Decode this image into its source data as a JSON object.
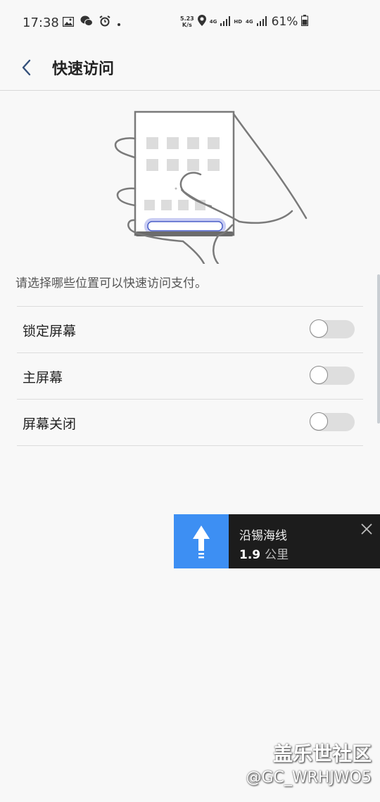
{
  "status_bar": {
    "time": "17:38",
    "net_speed_value": "5.23",
    "net_speed_unit": "K/s",
    "net_tag_1": "4G",
    "hd_tag": "HD",
    "net_tag_2": "4G",
    "battery_percent": "61%",
    "icons": [
      "gallery-icon",
      "wechat-icon",
      "alarm-icon",
      "dot-icon",
      "location-icon",
      "signal-icon",
      "battery-icon"
    ]
  },
  "app_bar": {
    "title": "快速访问"
  },
  "description": "请选择哪些位置可以快速访问支付。",
  "settings": [
    {
      "label": "锁定屏幕",
      "enabled": false
    },
    {
      "label": "主屏幕",
      "enabled": false
    },
    {
      "label": "屏幕关闭",
      "enabled": false
    }
  ],
  "navigation": {
    "street": "沿锡海线",
    "distance": "1.9",
    "unit": "公里",
    "accent_color": "#3d8ff3"
  },
  "watermark": {
    "title": "盖乐世社区",
    "handle": "@GC_WRHJWO5"
  }
}
